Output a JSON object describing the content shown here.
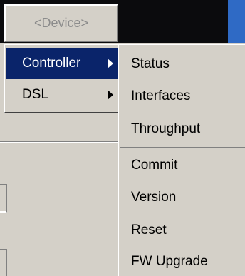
{
  "device_menu": {
    "label": "<Device>"
  },
  "submenu": {
    "items": [
      {
        "label": "Controller",
        "selected": true,
        "has_submenu": true
      },
      {
        "label": "DSL",
        "selected": false,
        "has_submenu": true
      }
    ]
  },
  "controller_menu": {
    "items": [
      {
        "label": "Status"
      },
      {
        "label": "Interfaces"
      },
      {
        "label": "Throughput"
      },
      {
        "label": "Commit"
      },
      {
        "label": "Version"
      },
      {
        "label": "Reset"
      },
      {
        "label": "FW Upgrade"
      }
    ]
  },
  "colors": {
    "menu_background": "#d4d0c8",
    "selection_background": "#0a246a",
    "selection_text": "#ffffff",
    "disabled_text": "#8c8c8c",
    "top_strip": "#0b0b0d",
    "accent_blue": "#2f6ac5"
  }
}
